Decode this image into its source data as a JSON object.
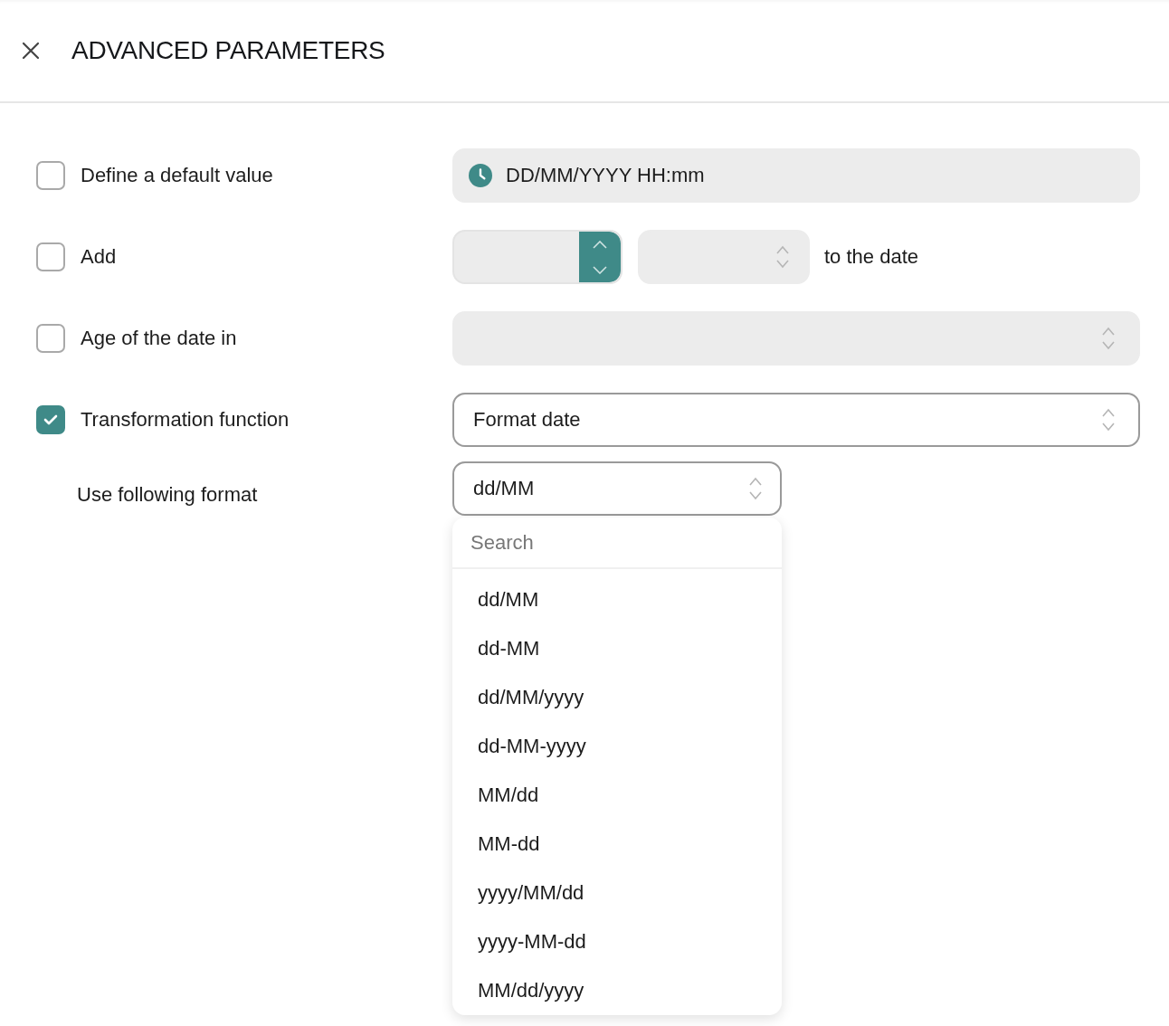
{
  "header": {
    "title": "ADVANCED PARAMETERS"
  },
  "options": [
    {
      "kind": "date_field",
      "label": "Define a default value",
      "checked": false,
      "value": "DD/MM/YYYY HH:mm"
    },
    {
      "kind": "offset",
      "label": "Add",
      "checked": false,
      "suffix": "to the date"
    },
    {
      "kind": "select",
      "label": "Age of the date in",
      "checked": false
    },
    {
      "kind": "select",
      "label": "Transformation function",
      "checked": true,
      "value": "Format date"
    }
  ],
  "format": {
    "label": "Use following format",
    "value": "dd/MM",
    "open": true,
    "search_placeholder": "Search",
    "options": [
      "dd/MM",
      "dd-MM",
      "dd/MM/yyyy",
      "dd-MM-yyyy",
      "MM/dd",
      "MM-dd",
      "yyyy/MM/dd",
      "yyyy-MM-dd",
      "MM/dd/yyyy"
    ]
  }
}
